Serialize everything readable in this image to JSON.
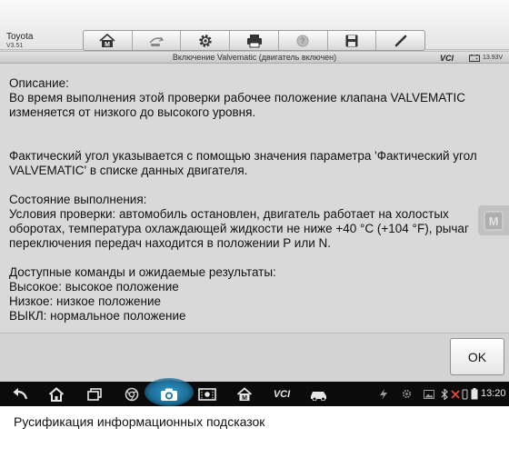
{
  "brand": {
    "make": "Toyota",
    "version": "V3.51"
  },
  "toolbar": {
    "buttons": [
      {
        "name": "home-button",
        "icon": "m-home-icon"
      },
      {
        "name": "vehicle-swap-button",
        "icon": "vehicle-swap-icon"
      },
      {
        "name": "settings-button",
        "icon": "gear-icon"
      },
      {
        "name": "print-button",
        "icon": "printer-icon"
      },
      {
        "name": "help-button",
        "icon": "help-icon"
      },
      {
        "name": "save-button",
        "icon": "floppy-icon"
      },
      {
        "name": "edit-button",
        "icon": "pen-icon"
      }
    ]
  },
  "titlebar": {
    "title": "Включение Valvematic (двигатель включен)",
    "vci": "VCI",
    "voltage": "13.93V"
  },
  "content": {
    "description_heading": "Описание:",
    "description_line1": "Во время выполнения этой проверки рабочее положение клапана VALVEMATIC",
    "description_line2": "изменяется от низкого до высокого уровня.",
    "angle_line1": "Фактический угол указывается с помощью значения параметра 'Фактический угол",
    "angle_line2": "VALVEMATIC' в списке данных двигателя.",
    "conditions_heading": "Состояние выполнения:",
    "conditions_line1": "Условия проверки: автомобиль остановлен, двигатель работает на холостых",
    "conditions_line2": "оборотах, температура охлаждающей жидкости не ниже +40 °C (+104 °F), рычаг",
    "conditions_line3": "переключения передач находится в положении P или N.",
    "commands_heading": "Доступные команды и ожидаемые результаты:",
    "command_high": "Высокое: высокое положение",
    "command_low": "Низкое: низкое положение",
    "command_off": "ВЫКЛ: нормальное положение"
  },
  "actions": {
    "ok_label": "OK"
  },
  "navbar": {
    "vci_label": "VCI",
    "time": "13:20"
  },
  "caption": "Русификация информационных подсказок",
  "colors": {
    "screen_bg": "#d9d9d9",
    "navbar_bg": "#0b0b0b",
    "camera_highlight": "#2f9bd0"
  }
}
